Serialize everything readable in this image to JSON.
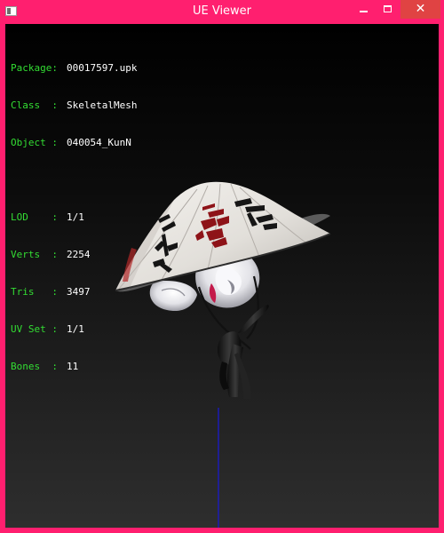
{
  "window": {
    "title": "UE Viewer",
    "buttons": {
      "minimize": "minimize",
      "maximize": "maximize",
      "close": "✕"
    }
  },
  "colors": {
    "title_bar": "#ff1f6f",
    "close_button": "#e04343",
    "label_text": "#33dd33",
    "value_text": "#ffffff",
    "axis_line": "#1a1acc"
  },
  "info": {
    "package_label": "Package:",
    "package_value": "00017597.upk",
    "class_label": "Class  :",
    "class_value": "SkeletalMesh",
    "object_label": "Object :",
    "object_value": "040054_KunN",
    "lod_label": "LOD    :",
    "lod_value": "1/1",
    "verts_label": "Verts  :",
    "verts_value": "2254",
    "tris_label": "Tris   :",
    "tris_value": "3497",
    "uvset_label": "UV Set :",
    "uvset_value": "1/1",
    "bones_label": "Bones  :",
    "bones_value": "11"
  },
  "icons": {
    "app": "app-window-icon",
    "minimize": "minimize-icon",
    "maximize": "maximize-icon",
    "close": "close-icon"
  }
}
